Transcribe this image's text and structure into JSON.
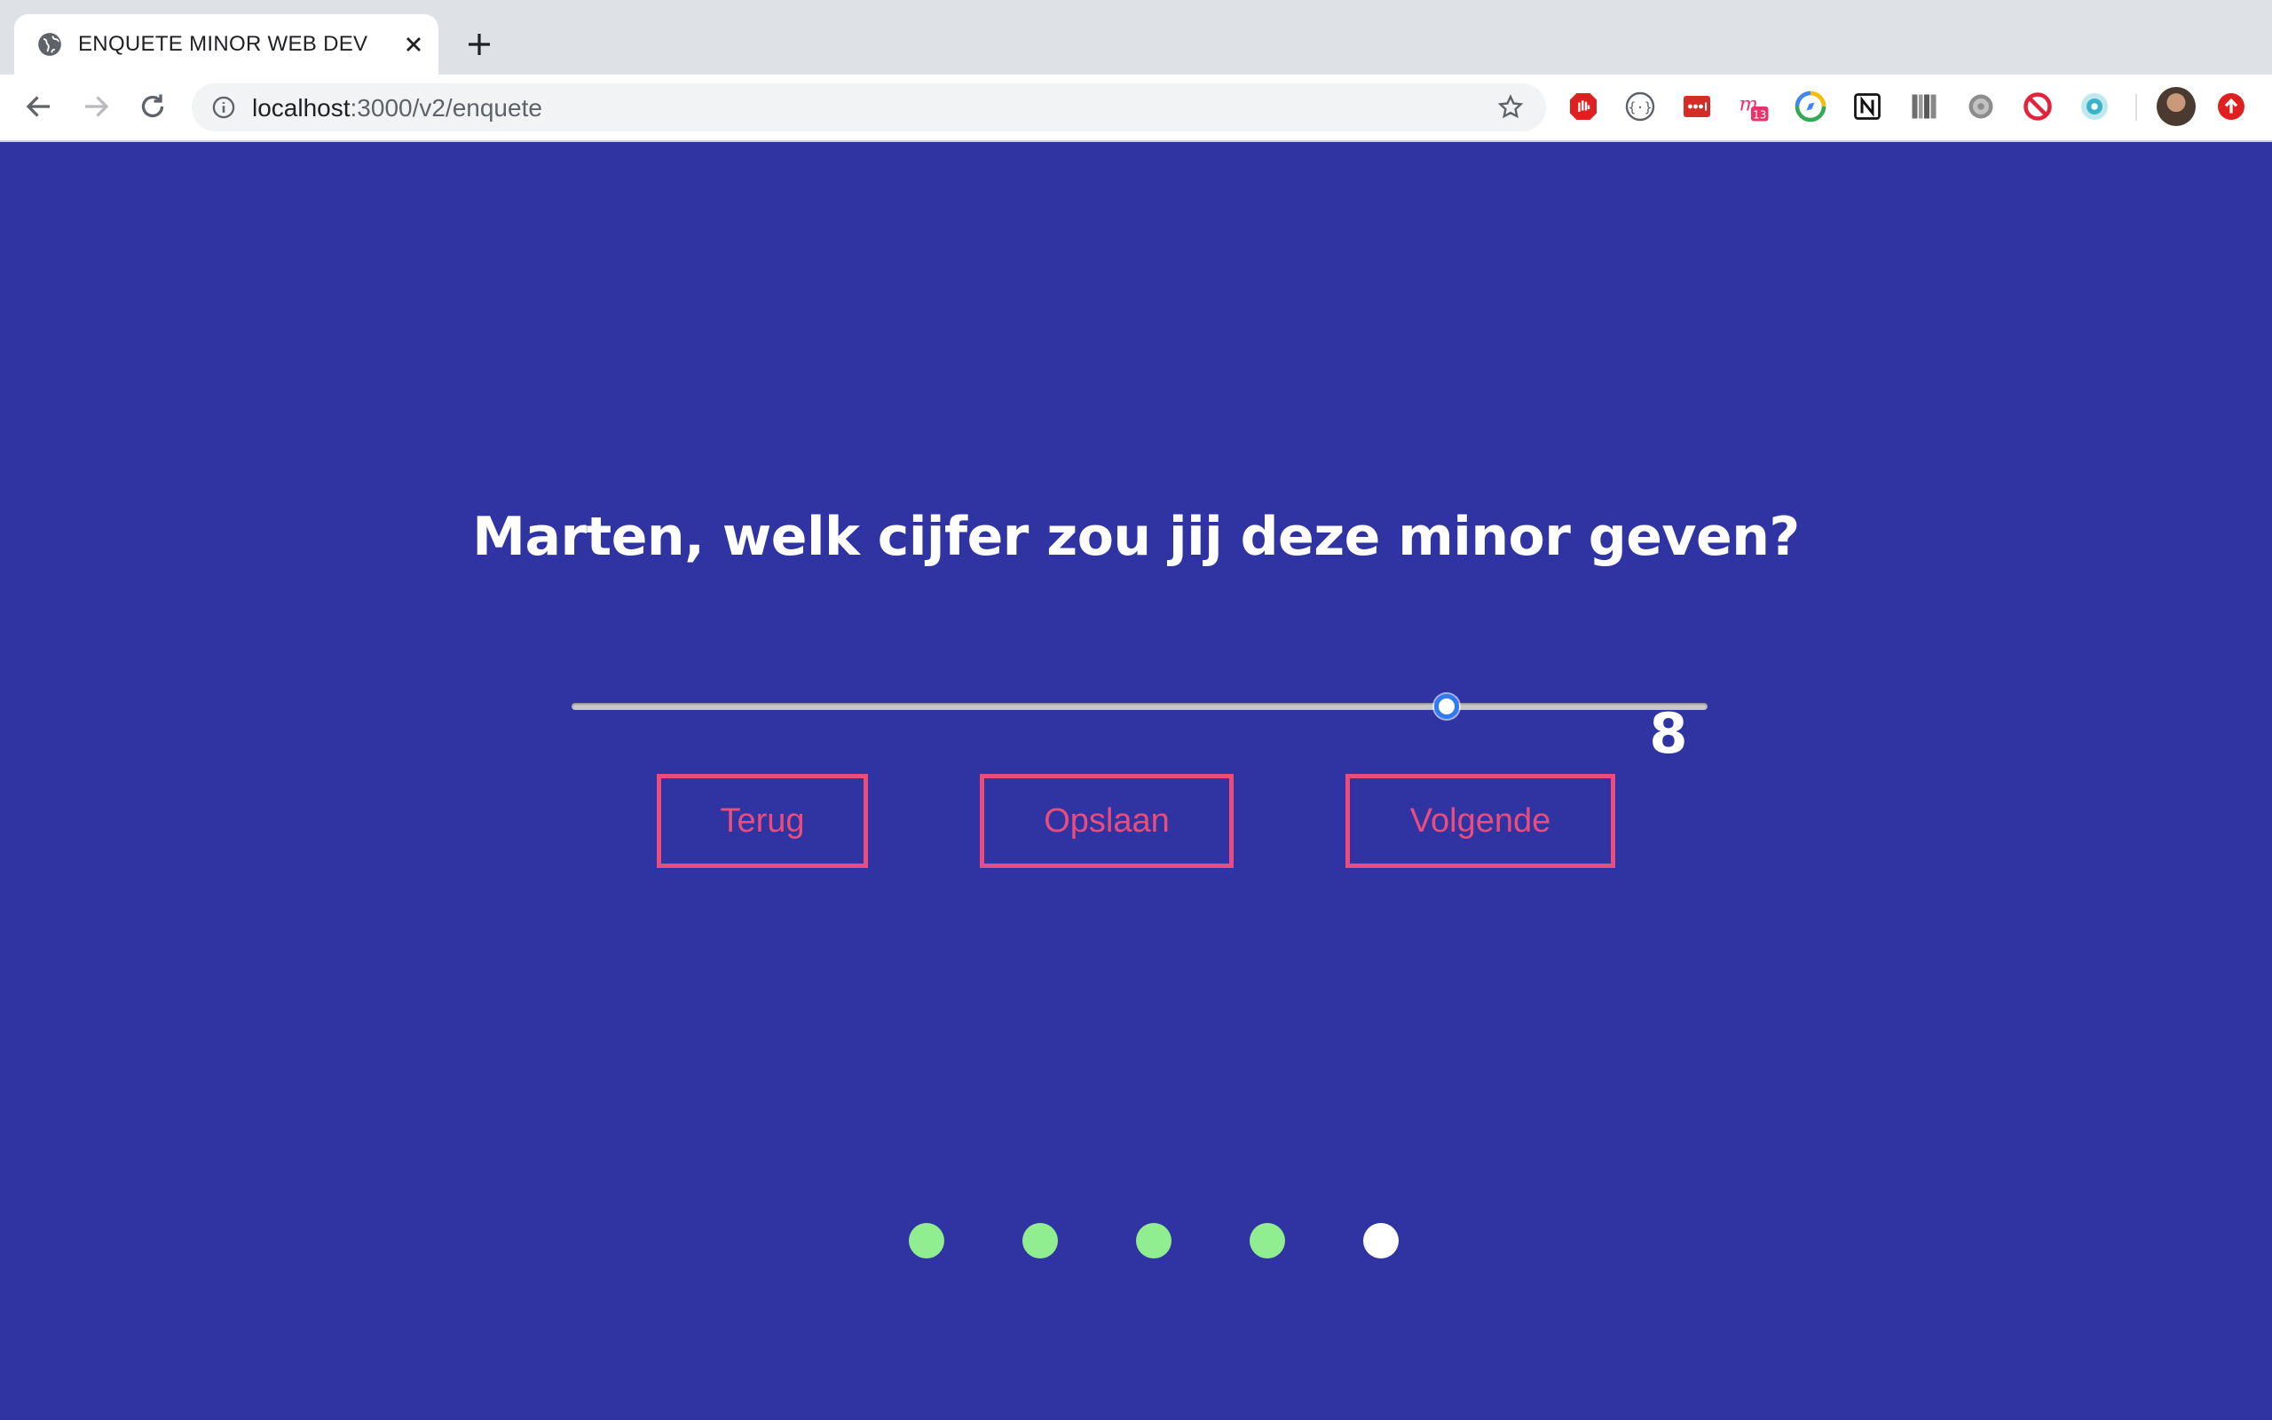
{
  "browser": {
    "tab_title": "ENQUETE MINOR WEB DEV",
    "url_host": "localhost",
    "url_path": ":3000/v2/enquete",
    "extension_badge": "13"
  },
  "survey": {
    "question": "Marten, welk cijfer zou jij deze minor geven?",
    "slider_value": "8",
    "slider_fraction": 0.77,
    "buttons": {
      "back": "Terug",
      "save": "Opslaan",
      "next": "Volgende"
    },
    "progress": {
      "steps_total": 5,
      "current_step": 5,
      "completed_color": "#90ee90",
      "current_color": "#ffffff"
    }
  },
  "colors": {
    "page_background": "#3034a2",
    "button_accent": "#ea4d7b",
    "text": "#ffffff"
  }
}
